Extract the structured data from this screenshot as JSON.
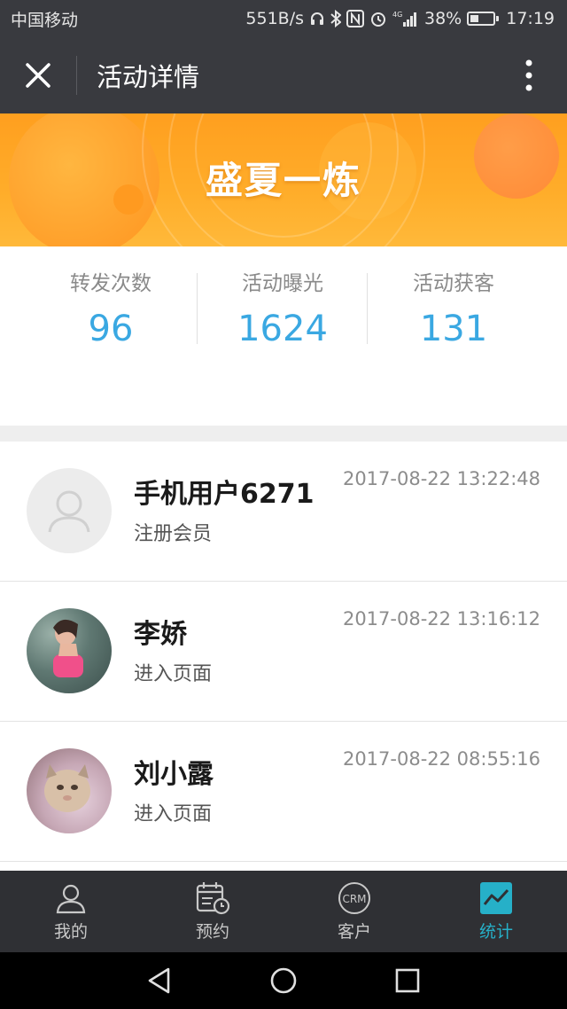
{
  "status_bar": {
    "carrier": "中国移动",
    "speed": "551B/s",
    "signal_label": "4G",
    "battery": "38%",
    "battery_level": 0.38,
    "time": "17:19"
  },
  "nav": {
    "title": "活动详情"
  },
  "banner": {
    "title": "盛夏一炼"
  },
  "stats": [
    {
      "label": "转发次数",
      "value": "96"
    },
    {
      "label": "活动曝光",
      "value": "1624"
    },
    {
      "label": "活动获客",
      "value": "131"
    }
  ],
  "list": [
    {
      "name": "手机用户6271",
      "action": "注册会员",
      "time": "2017-08-22 13:22:48",
      "avatar": "default-avatar-icon"
    },
    {
      "name": "李娇",
      "action": "进入页面",
      "time": "2017-08-22 13:16:12",
      "avatar": "photo-avatar"
    },
    {
      "name": "刘小露",
      "action": "进入页面",
      "time": "2017-08-22 08:55:16",
      "avatar": "photo-avatar"
    }
  ],
  "tabs": [
    {
      "label": "我的",
      "icon": "person-icon"
    },
    {
      "label": "预约",
      "icon": "calendar-clock-icon"
    },
    {
      "label": "客户",
      "icon": "crm-icon"
    },
    {
      "label": "统计",
      "icon": "chart-icon",
      "active": true
    }
  ],
  "colors": {
    "accent": "#26b0c8",
    "stat_value": "#3aa8e2",
    "banner": "#ffa726",
    "nav_bg": "#393a3f"
  }
}
